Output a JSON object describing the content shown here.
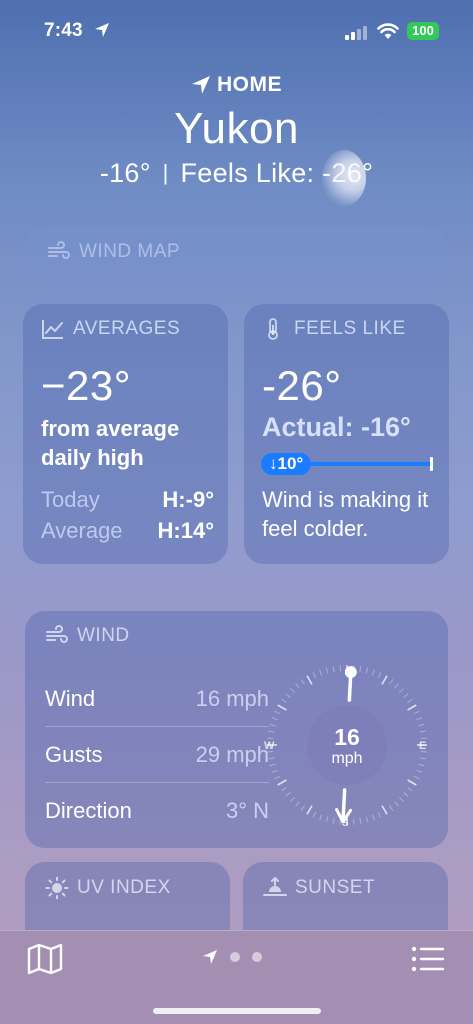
{
  "status": {
    "time": "7:43",
    "battery": "100"
  },
  "header": {
    "home_label": "HOME",
    "city": "Yukon",
    "current_temp": "-16°",
    "separator": "|",
    "feels_like_text": "Feels Like: -26°"
  },
  "wind_map": {
    "title": "WIND MAP"
  },
  "averages": {
    "title": "AVERAGES",
    "value": "−23°",
    "description": "from average daily high",
    "rows": [
      {
        "label": "Today",
        "value": "H:-9°"
      },
      {
        "label": "Average",
        "value": "H:14°"
      }
    ]
  },
  "feels_like": {
    "title": "FEELS LIKE",
    "value": "-26°",
    "actual": "Actual: -16°",
    "difference": "↓10°",
    "description": "Wind is making it feel colder."
  },
  "wind": {
    "title": "WIND",
    "rows": [
      {
        "label": "Wind",
        "value": "16 mph"
      },
      {
        "label": "Gusts",
        "value": "29 mph"
      },
      {
        "label": "Direction",
        "value": "3° N"
      }
    ],
    "compass": {
      "speed": "16",
      "unit": "mph",
      "west": "W",
      "east": "E",
      "south": "S",
      "direction_degrees": 3
    }
  },
  "uv_index": {
    "title": "UV INDEX"
  },
  "sunset": {
    "title": "SUNSET"
  },
  "colors": {
    "accent": "#1a7cff",
    "battery": "#34c759"
  },
  "icons": {
    "status": [
      "location-arrow-icon",
      "cellular-signal-icon",
      "wifi-icon"
    ],
    "tabbar": [
      "map-icon",
      "location-arrow-icon",
      "list-icon"
    ]
  }
}
